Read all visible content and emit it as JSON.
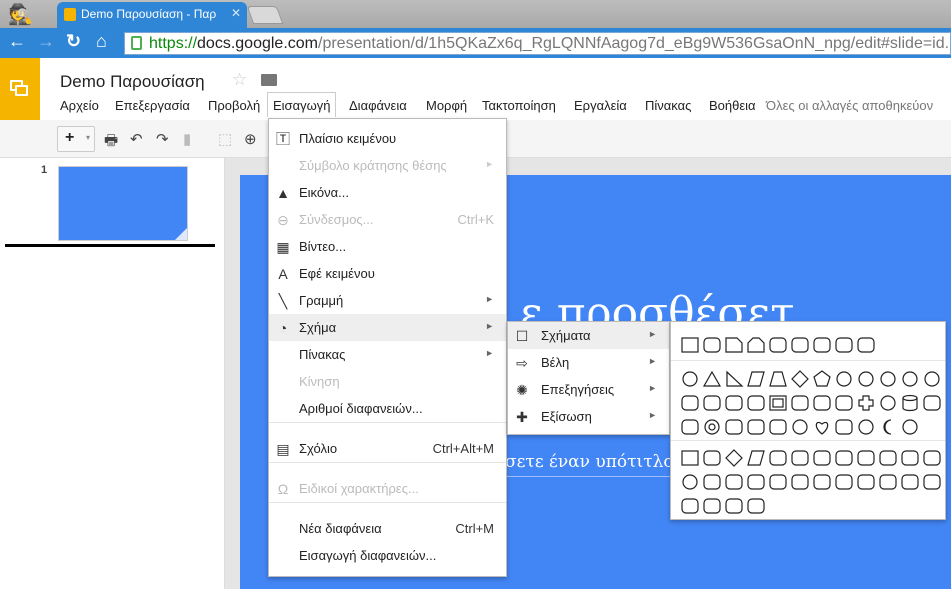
{
  "browser": {
    "tab_title": "Demo Παρουσίαση - Παρ",
    "url_scheme": "https://",
    "url_host": "docs.google.com",
    "url_path": "/presentation/d/1h5QKaZx6q_RgLQNNfAagog7d_eBg9W536GsaOnN_npg/edit#slide=id.p"
  },
  "app": {
    "title": "Demo Παρουσίαση",
    "accent": "#f4b400",
    "slide_color": "#4285f4",
    "menu": [
      "Αρχείο",
      "Επεξεργασία",
      "Προβολή",
      "Εισαγωγή",
      "Διαφάνεια",
      "Μορφή",
      "Τακτοποίηση",
      "Εργαλεία",
      "Πίνακας",
      "Βοήθεια"
    ],
    "save_status": "Όλες οι αλλαγές αποθηκεύον"
  },
  "filmstrip": {
    "slide_number": "1"
  },
  "slide": {
    "title_visible": "ε προσθέσετ",
    "subtitle_visible": "σετε έναν υπότιτλο"
  },
  "insert_menu": [
    {
      "label": "Πλαίσιο κειμένου",
      "icon": "text-box-icon"
    },
    {
      "label": "Σύμβολο κράτησης θέσης",
      "disabled": true,
      "submenu": true
    },
    {
      "label": "Εικόνα...",
      "icon": "image-icon"
    },
    {
      "label": "Σύνδεσμος...",
      "icon": "link-icon",
      "shortcut": "Ctrl+K",
      "disabled": true
    },
    {
      "label": "Βίντεο...",
      "icon": "video-icon"
    },
    {
      "label": "Εφέ κειμένου",
      "icon": "word-art-icon"
    },
    {
      "label": "Γραμμή",
      "icon": "line-icon",
      "submenu": true
    },
    {
      "label": "Σχήμα",
      "icon": "shape-icon",
      "submenu": true,
      "highlighted": true
    },
    {
      "label": "Πίνακας",
      "submenu": true
    },
    {
      "label": "Κίνηση",
      "disabled": true
    },
    {
      "label": "Αριθμοί διαφανειών..."
    },
    {
      "label": "Σχόλιο",
      "icon": "comment-icon",
      "shortcut": "Ctrl+Alt+M"
    },
    {
      "label": "Ειδικοί χαρακτήρες...",
      "icon": "omega-icon",
      "disabled": true
    },
    {
      "label": "Νέα διαφάνεια",
      "shortcut": "Ctrl+M"
    },
    {
      "label": "Εισαγωγή διαφανειών..."
    }
  ],
  "shape_submenu": [
    {
      "label": "Σχήματα",
      "icon": "square-icon",
      "highlighted": true
    },
    {
      "label": "Βέλη",
      "icon": "arrow-icon"
    },
    {
      "label": "Επεξηγήσεις",
      "icon": "callout-icon"
    },
    {
      "label": "Εξίσωση",
      "icon": "plus-icon"
    }
  ],
  "shapes_palette": {
    "rectangles": [
      "rect",
      "round",
      "snip",
      "snip2",
      "snipdiag",
      "roundsnip",
      "round1",
      "round2",
      "rounddiag"
    ],
    "basic": [
      [
        "circle",
        "triangle",
        "rtriangle",
        "parallelogram",
        "trapezoid",
        "diamond",
        "pentagon",
        "hex6",
        "hept7",
        "oct8",
        "dec10",
        "dod12"
      ],
      [
        "pie",
        "arc",
        "teardrop",
        "chord",
        "frame",
        "halfframe",
        "lshape",
        "diagstripe",
        "cross",
        "plaque",
        "can",
        "cube"
      ],
      [
        "bevel",
        "donut",
        "nosymbol",
        "blockarc",
        "foldedcorner",
        "smiley",
        "heart",
        "lightning",
        "sun",
        "moon",
        "cloud"
      ]
    ],
    "flowchart": [
      [
        "rect",
        "round",
        "diamond",
        "parallelogram",
        "predefined",
        "internal",
        "document",
        "multidoc",
        "terminator",
        "preparation",
        "manualinput",
        "manualop"
      ],
      [
        "circle",
        "offpage",
        "card",
        "tape",
        "sumjunction",
        "or",
        "collate",
        "sort",
        "extract",
        "merge",
        "storeddata",
        "delay"
      ],
      [
        "seqaccess",
        "magdisk",
        "directaccess",
        "display"
      ]
    ]
  }
}
